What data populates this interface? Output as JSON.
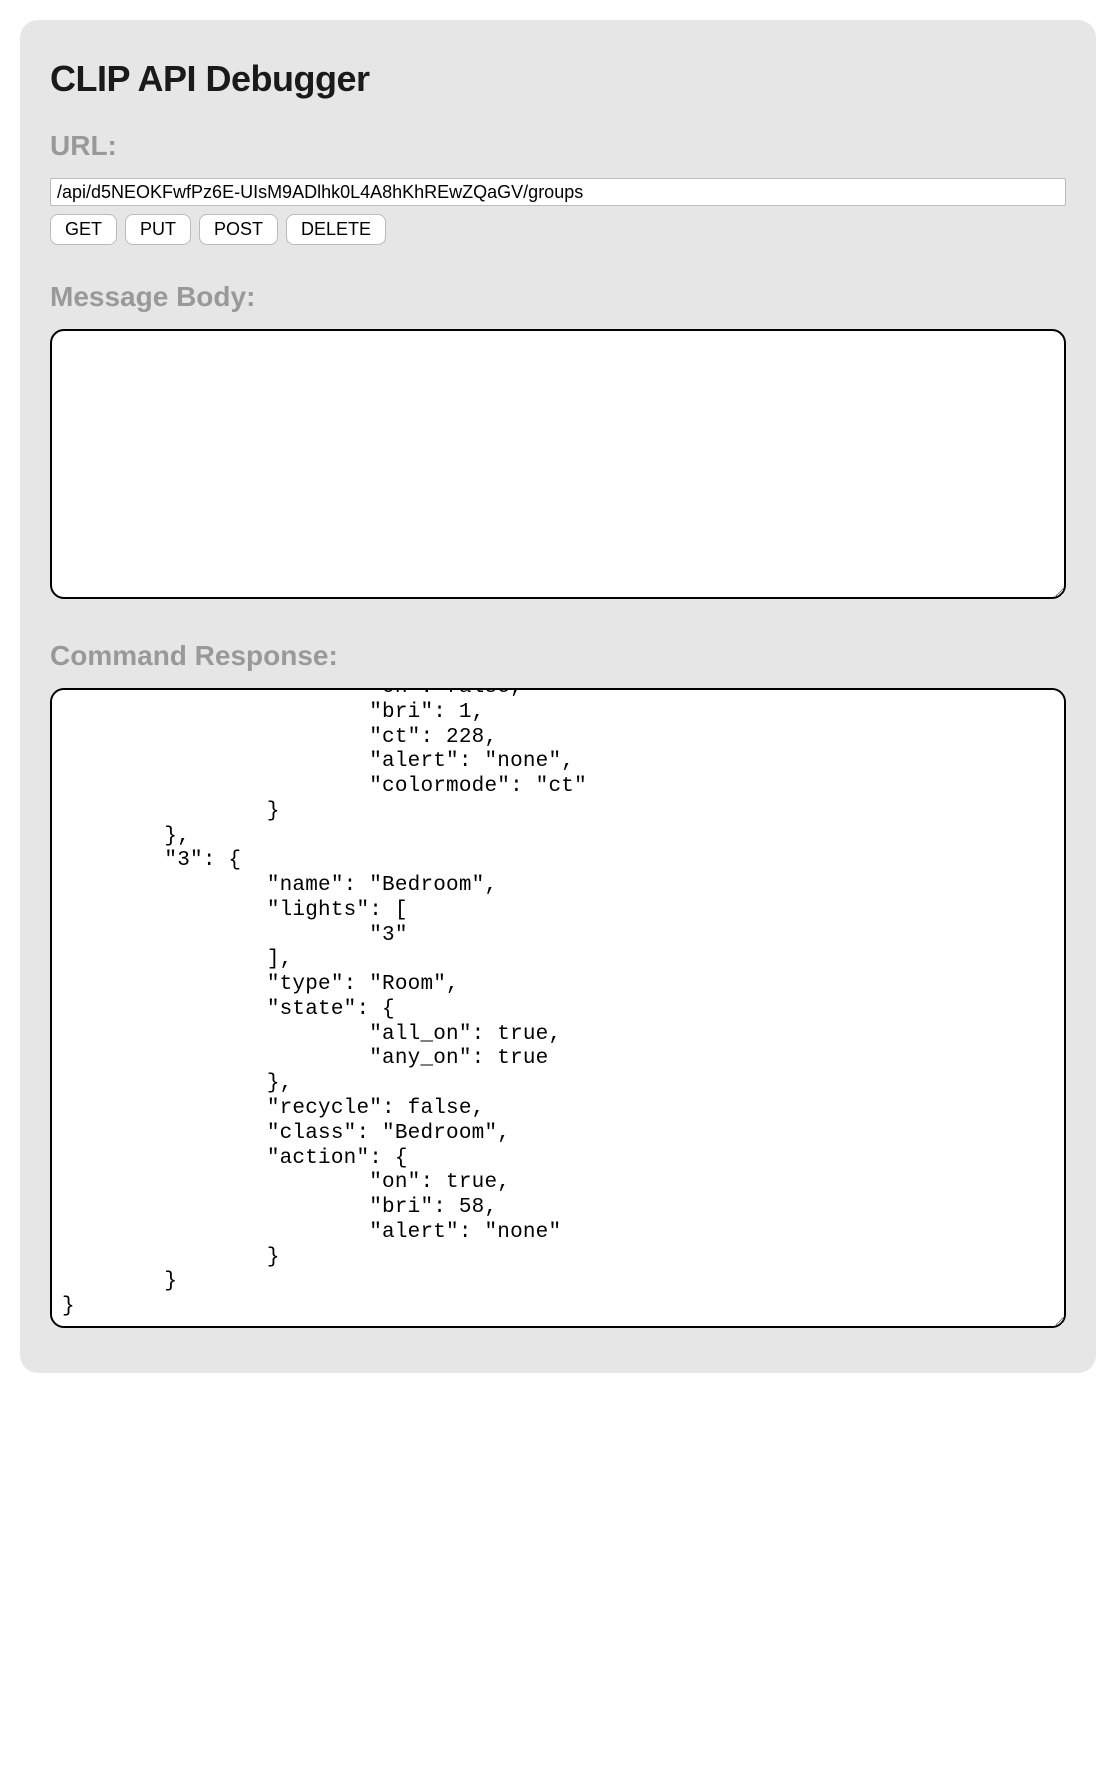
{
  "header": {
    "title": "CLIP API Debugger"
  },
  "url_section": {
    "label": "URL:",
    "input_value": "/api/d5NEOKFwfPz6E-UIsM9ADlhk0L4A8hKhREwZQaGV/groups",
    "buttons": {
      "get": "GET",
      "put": "PUT",
      "post": "POST",
      "delete": "DELETE"
    }
  },
  "message_body": {
    "label": "Message Body:",
    "value": ""
  },
  "command_response": {
    "label": "Command Response:",
    "value": "                        \"on\": false,\n                        \"bri\": 1,\n                        \"ct\": 228,\n                        \"alert\": \"none\",\n                        \"colormode\": \"ct\"\n                }\n        },\n        \"3\": {\n                \"name\": \"Bedroom\",\n                \"lights\": [\n                        \"3\"\n                ],\n                \"type\": \"Room\",\n                \"state\": {\n                        \"all_on\": true,\n                        \"any_on\": true\n                },\n                \"recycle\": false,\n                \"class\": \"Bedroom\",\n                \"action\": {\n                        \"on\": true,\n                        \"bri\": 58,\n                        \"alert\": \"none\"\n                }\n        }\n}"
  }
}
